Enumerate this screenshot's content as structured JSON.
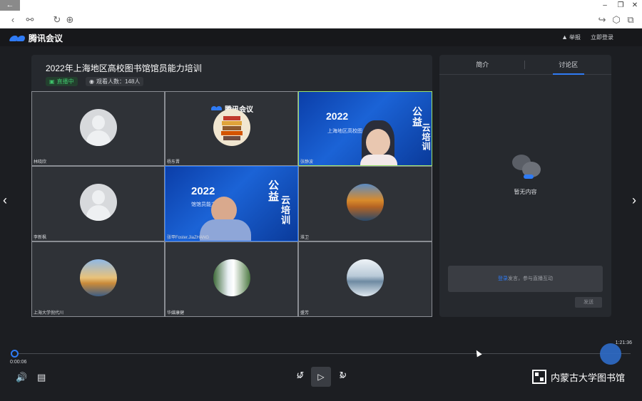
{
  "browser": {
    "back_label": "←",
    "win_controls": [
      "–",
      "❐",
      "✕"
    ],
    "nav_icons": [
      "chevron-left-icon",
      "link-icon",
      "refresh-icon",
      "globe-icon"
    ],
    "right_icons": [
      "share-icon",
      "cube-icon",
      "extension-icon"
    ]
  },
  "header": {
    "app_name": "腾讯会议",
    "report_label": "举报",
    "login_label": "立即登录"
  },
  "meeting": {
    "title": "2022年上海地区高校图书馆馆员能力培训",
    "status": "直播中",
    "viewers": "观看人数：148人"
  },
  "tiles": [
    {
      "name": "林晓欣"
    },
    {
      "name": "杨东晋",
      "overlay": "腾讯会议"
    },
    {
      "name": "张静波"
    },
    {
      "name": "李新枫"
    },
    {
      "name": "张甲Foster.JiaZHANG"
    },
    {
      "name": "淮卫"
    },
    {
      "name": "上海大学倪代川"
    },
    {
      "name": "华媒康健"
    },
    {
      "name": "盛芳"
    }
  ],
  "slide": {
    "year": "2022",
    "subtitle": "上海地区高校图书馆馆员能力培训",
    "subtitle_short": "上海地区高校图",
    "subtitle_cut": "馆馆员能力培训",
    "vertical_left": "公益",
    "vertical_right": "云培训"
  },
  "side": {
    "tabs": [
      "简介",
      "讨论区"
    ],
    "active_tab": "讨论区",
    "empty_text": "暂无内容",
    "login_link": "登录",
    "login_tail": "发言，参与直播互动",
    "send_label": "发送"
  },
  "player": {
    "current_time": "0:00:06",
    "total_time": "1:21:36",
    "rewind_label": "10",
    "forward_label": "30",
    "watermark": "内蒙古大学图书馆"
  }
}
